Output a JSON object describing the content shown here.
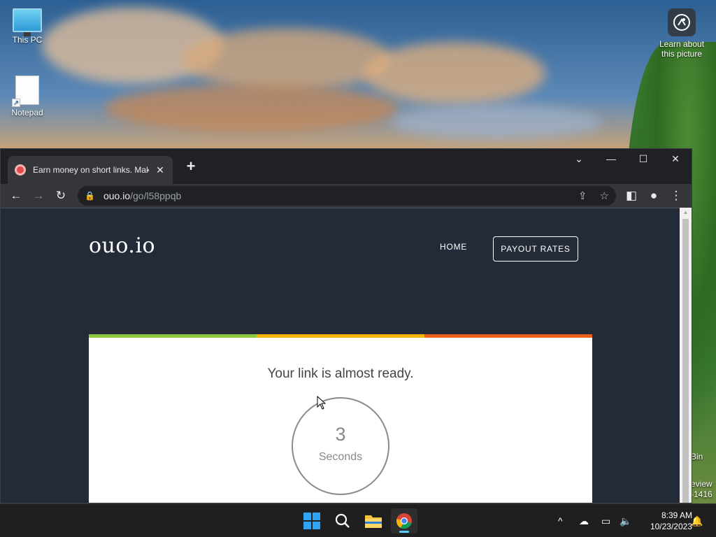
{
  "desktop": {
    "icons": [
      {
        "label": "This PC",
        "icon": "monitor-icon"
      },
      {
        "label": "Notepad",
        "icon": "notepad-icon"
      }
    ],
    "learn": {
      "label_line1": "Learn about",
      "label_line2": "this picture",
      "icon": "camera-icon"
    },
    "recycle_partial": {
      "line1": "Bin",
      "line2": "eview",
      "line3": "-1416"
    }
  },
  "browser": {
    "tab_title": "Earn money on short links. Make",
    "tab_close": "✕",
    "new_tab": "+",
    "window_controls": {
      "dropdown": "⌄",
      "minimize": "—",
      "maximize": "☐",
      "close": "✕"
    },
    "url_host": "ouo.io",
    "url_path": "/go/l58ppqb"
  },
  "page": {
    "logo": "ouo.io",
    "nav_home": "HOME",
    "nav_payout": "PAYOUT RATES",
    "message": "Your link is almost ready.",
    "countdown_value": "3",
    "countdown_unit": "Seconds",
    "bar_colors": [
      "#8dc63f",
      "#f6b40e",
      "#ea5f1a"
    ]
  },
  "taskbar": {
    "time": "8:39 AM",
    "date": "10/23/2023"
  }
}
